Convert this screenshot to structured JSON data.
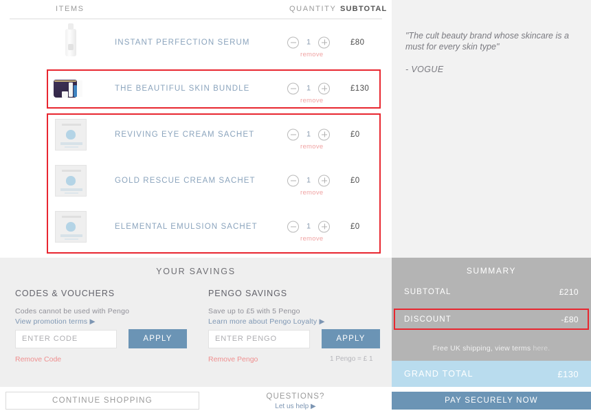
{
  "cart": {
    "headers": {
      "items": "ITEMS",
      "quantity": "QUANTITY",
      "subtotal": "SUBTOTAL"
    },
    "remove_label": "remove",
    "items": [
      {
        "name": "INSTANT PERFECTION SERUM",
        "qty": "1",
        "price": "£80",
        "thumb": "serum-bottle"
      },
      {
        "name": "THE BEAUTIFUL SKIN BUNDLE",
        "qty": "1",
        "price": "£130",
        "thumb": "purple-pouch"
      },
      {
        "name": "REVIVING EYE CREAM SACHET",
        "qty": "1",
        "price": "£0",
        "thumb": "sachet"
      },
      {
        "name": "GOLD RESCUE CREAM SACHET",
        "qty": "1",
        "price": "£0",
        "thumb": "sachet"
      },
      {
        "name": "ELEMENTAL EMULSION SACHET",
        "qty": "1",
        "price": "£0",
        "thumb": "sachet"
      }
    ]
  },
  "quote": {
    "text": "\"The cult beauty brand whose skincare is a must for every skin type\"",
    "source": "- VOGUE"
  },
  "savings": {
    "title": "YOUR SAVINGS",
    "codes": {
      "heading": "CODES & VOUCHERS",
      "note": "Codes cannot be used with Pengo",
      "link": "View promotion terms ▶",
      "placeholder": "ENTER CODE",
      "apply": "APPLY",
      "remove": "Remove Code"
    },
    "pengo": {
      "heading": "PENGO SAVINGS",
      "note": "Save up to £5 with 5 Pengo",
      "link": "Learn more about Pengo Loyalty ▶",
      "placeholder": "ENTER PENGO",
      "apply": "APPLY",
      "remove": "Remove Pengo",
      "rate": "1 Pengo = £ 1"
    }
  },
  "summary": {
    "title": "SUMMARY",
    "subtotal_label": "SUBTOTAL",
    "subtotal_value": "£210",
    "discount_label": "DISCOUNT",
    "discount_value": "-£80",
    "shipping_text": "Free UK shipping, view terms ",
    "shipping_link": "here.",
    "grand_label": "GRAND TOTAL",
    "grand_value": "£130"
  },
  "footer": {
    "continue": "CONTINUE SHOPPING",
    "questions": "QUESTIONS?",
    "help": "Let us help ▶",
    "pay": "PAY SECURELY NOW"
  },
  "colors": {
    "accent_blue": "#6b94b5",
    "grand_total_bg": "#b9dcee",
    "summary_bg": "#b4b4b4",
    "highlight_red": "#e8262f",
    "link_blue": "#7d96b3",
    "remove_pink": "#f0a3a3"
  }
}
